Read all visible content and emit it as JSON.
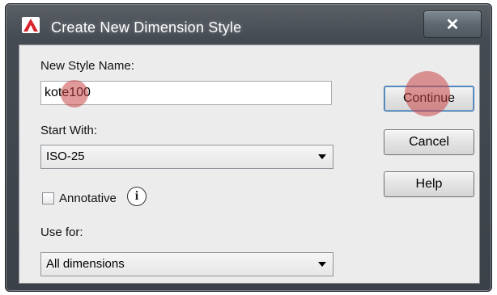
{
  "window": {
    "title": "Create New Dimension Style",
    "close_symbol": "✕"
  },
  "form": {
    "new_style_name_label": "New Style Name:",
    "new_style_name_value": "kote100",
    "start_with_label": "Start With:",
    "start_with_value": "ISO-25",
    "annotative_label": "Annotative",
    "annotative_checked": false,
    "use_for_label": "Use for:",
    "use_for_value": "All dimensions"
  },
  "buttons": {
    "continue": "Continue",
    "cancel": "Cancel",
    "help": "Help"
  },
  "colors": {
    "title_bar": "#454b52",
    "client_bg": "#ececec",
    "click_marker": "#c84646"
  },
  "icons": {
    "app": "autocad-icon",
    "info": "info-icon",
    "close": "close-icon",
    "dropdown": "chevron-down-icon"
  }
}
